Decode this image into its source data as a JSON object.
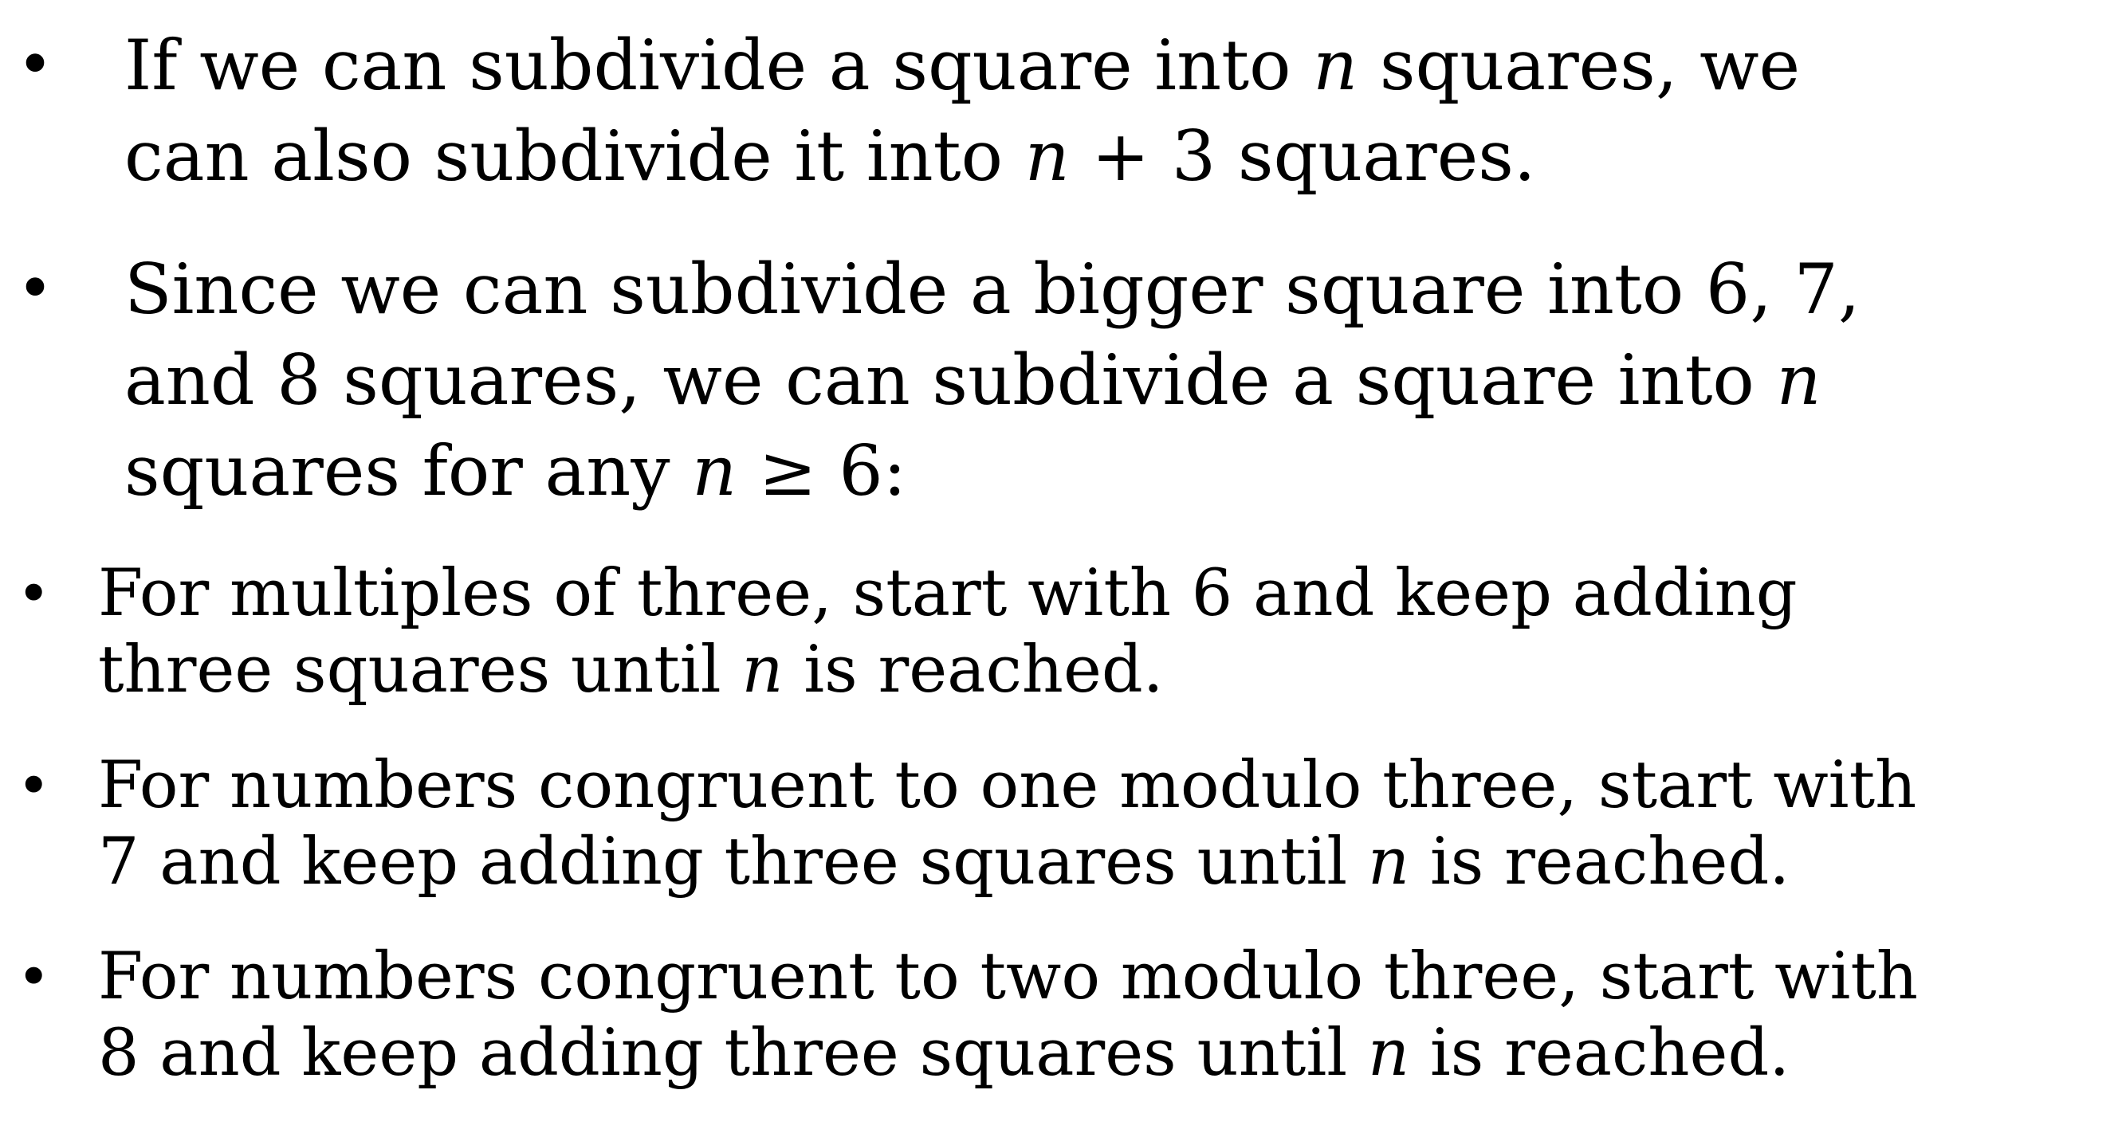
{
  "bullets": [
    {
      "marker": "•",
      "lines": [
        [
          "If we can subdivide a square into ",
          "n",
          " squares, we"
        ],
        [
          "can also subdivide it into ",
          "n",
          " + 3 squares."
        ]
      ]
    },
    {
      "marker": "•",
      "lines": [
        [
          "Since we can subdivide a bigger square into 6, 7,"
        ],
        [
          "and 8 squares, we can subdivide a square into ",
          "n"
        ],
        [
          "squares for any ",
          "n",
          " ≥ 6:"
        ]
      ]
    },
    {
      "marker": "•",
      "lines": [
        [
          "For multiples of three, start with 6 and keep adding"
        ],
        [
          "three squares until ",
          "n",
          " is reached."
        ]
      ]
    },
    {
      "marker": "•",
      "lines": [
        [
          "For numbers congruent to one modulo three, start with"
        ],
        [
          "7 and keep adding three squares until ",
          "n",
          " is reached."
        ]
      ]
    },
    {
      "marker": "•",
      "lines": [
        [
          "For numbers congruent to two modulo three, start with"
        ],
        [
          "8 and keep adding three squares until ",
          "n",
          " is reached."
        ]
      ]
    }
  ]
}
